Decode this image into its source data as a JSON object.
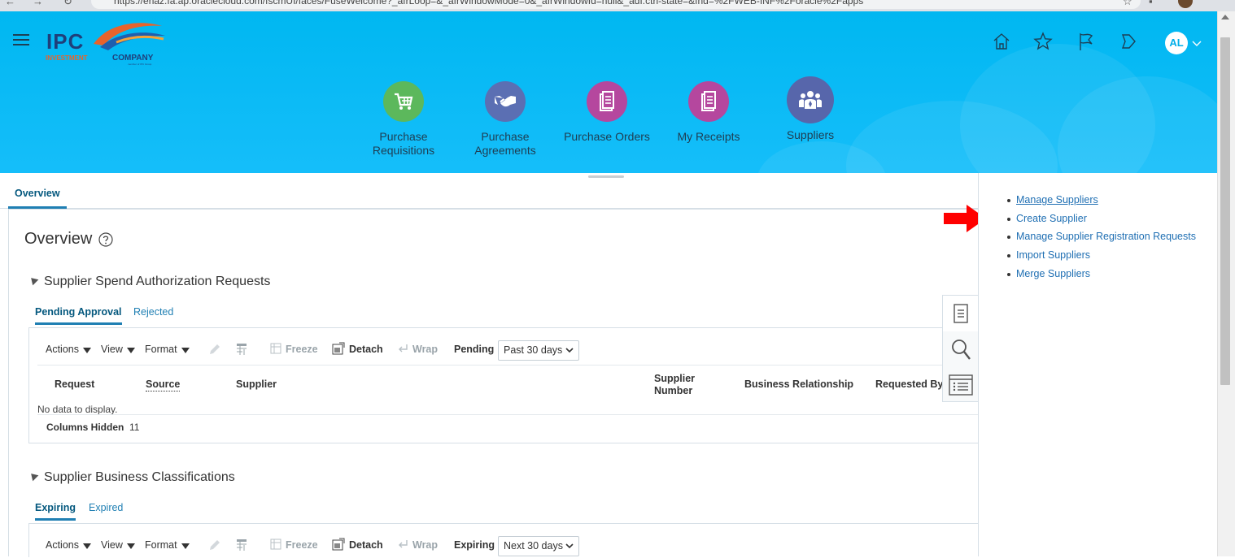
{
  "browser": {
    "url": "https://ehaz.fa.ap.oraclecloud.com/fscmUI/faces/FuseWelcome?_afrLoop=&_afrWindowMode=0&_afrWindowId=null&_adf.ctrl-state=&fnd=%2FWEB-INF%2Foracle%2Fapps"
  },
  "header": {
    "logo_main": "IPC",
    "logo_sub1": "INVESTMENT",
    "logo_sub2": "COMPANY",
    "logo_tag": "member of IPC Group",
    "avatar": "AL"
  },
  "apps": [
    {
      "label": "Purchase Requisitions"
    },
    {
      "label": "Purchase Agreements"
    },
    {
      "label": "Purchase Orders"
    },
    {
      "label": "My Receipts"
    },
    {
      "label": "Suppliers"
    }
  ],
  "tabs": {
    "overview": "Overview"
  },
  "page": {
    "title": "Overview"
  },
  "section1": {
    "title": "Supplier Spend Authorization Requests",
    "tabs": [
      "Pending Approval",
      "Rejected"
    ],
    "toolbar": {
      "actions": "Actions",
      "view": "View",
      "format": "Format",
      "freeze": "Freeze",
      "detach": "Detach",
      "wrap": "Wrap",
      "filter_label": "Pending",
      "filter_value": "Past 30 days"
    },
    "columns": [
      "Request",
      "Source",
      "Supplier",
      "Supplier Number",
      "Business Relationship",
      "Requested By"
    ],
    "empty_text": "No data to display.",
    "columns_hidden_label": "Columns Hidden",
    "columns_hidden_count": "11"
  },
  "section2": {
    "title": "Supplier Business Classifications",
    "tabs": [
      "Expiring",
      "Expired"
    ],
    "toolbar": {
      "actions": "Actions",
      "view": "View",
      "format": "Format",
      "freeze": "Freeze",
      "detach": "Detach",
      "wrap": "Wrap",
      "filter_label": "Expiring",
      "filter_value": "Next 30 days"
    }
  },
  "tasks": [
    "Manage Suppliers",
    "Create Supplier",
    "Manage Supplier Registration Requests",
    "Import Suppliers",
    "Merge Suppliers"
  ],
  "colors": {
    "header": "#00b7f1",
    "link": "#1f6fb3",
    "arrow": "#ff0000",
    "app_green": "#5cb85c",
    "app_blue": "#5b6fb3",
    "app_pink": "#b5479e",
    "app_indigo": "#5766ab"
  }
}
